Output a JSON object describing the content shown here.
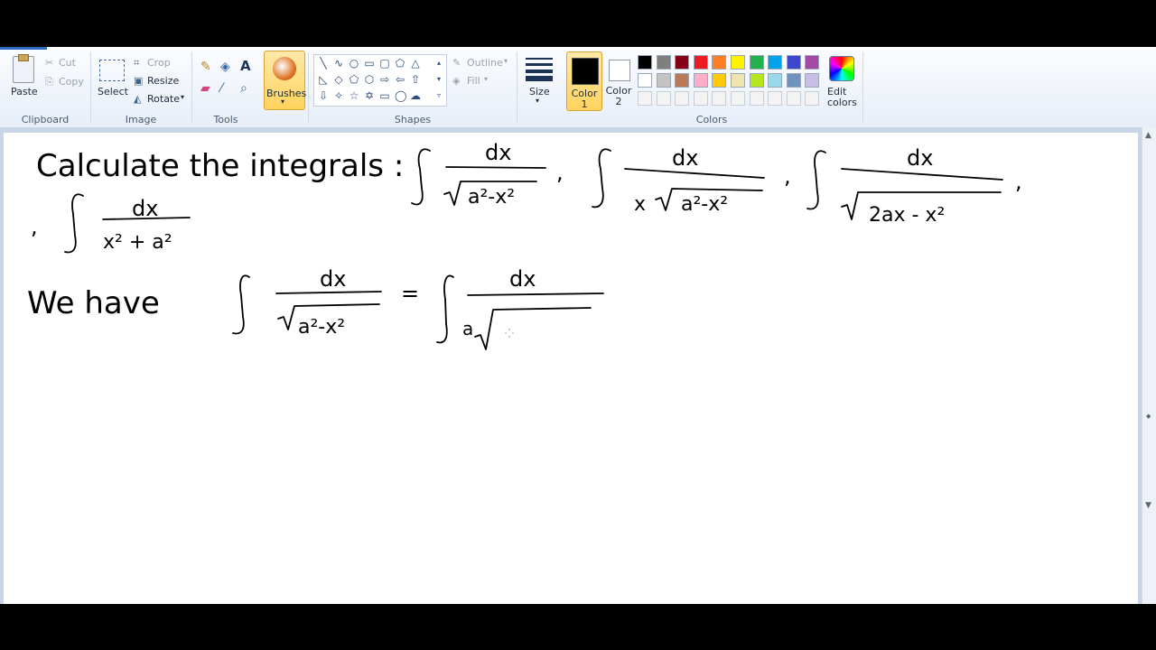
{
  "ribbon": {
    "clipboard": {
      "paste": "Paste",
      "cut": "Cut",
      "copy": "Copy",
      "label": "Clipboard"
    },
    "image": {
      "select": "Select",
      "crop": "Crop",
      "resize": "Resize",
      "rotate": "Rotate",
      "label": "Image"
    },
    "tools": {
      "label": "Tools",
      "text_tool": "A"
    },
    "brushes": {
      "label": "Brushes"
    },
    "shapes": {
      "outline": "Outline",
      "fill": "Fill",
      "label": "Shapes"
    },
    "size": {
      "label": "Size"
    },
    "colors": {
      "color1": "Color 1",
      "color2": "Color 2",
      "edit_line1": "Edit",
      "edit_line2": "colors",
      "label": "Colors",
      "palette_row1": [
        "#000000",
        "#7f7f7f",
        "#880015",
        "#ed1c24",
        "#ff7f27",
        "#fff200",
        "#22b14c",
        "#00a2e8",
        "#3f48cc",
        "#a349a4"
      ],
      "palette_row2": [
        "#ffffff",
        "#c3c3c3",
        "#b97a57",
        "#ffaec9",
        "#ffc90e",
        "#efe4b0",
        "#b5e61d",
        "#99d9ea",
        "#7092be",
        "#c8bfe7"
      ]
    }
  },
  "canvas": {
    "line1": "Calculate the integrals :",
    "f1_num": "dx",
    "f1_den": "a²-x²",
    "f2_num": "dx",
    "f2_den_x": "x",
    "f2_den": "a²-x²",
    "f3_num": "dx",
    "f3_den": "2ax - x²",
    "f4_num": "dx",
    "f4_den": "x² + a²",
    "line2": "We have",
    "w1_num": "dx",
    "w1_den": "a²-x²",
    "equals": "=",
    "w2_num": "dx",
    "w2_den_a": "a",
    "comma": ","
  }
}
